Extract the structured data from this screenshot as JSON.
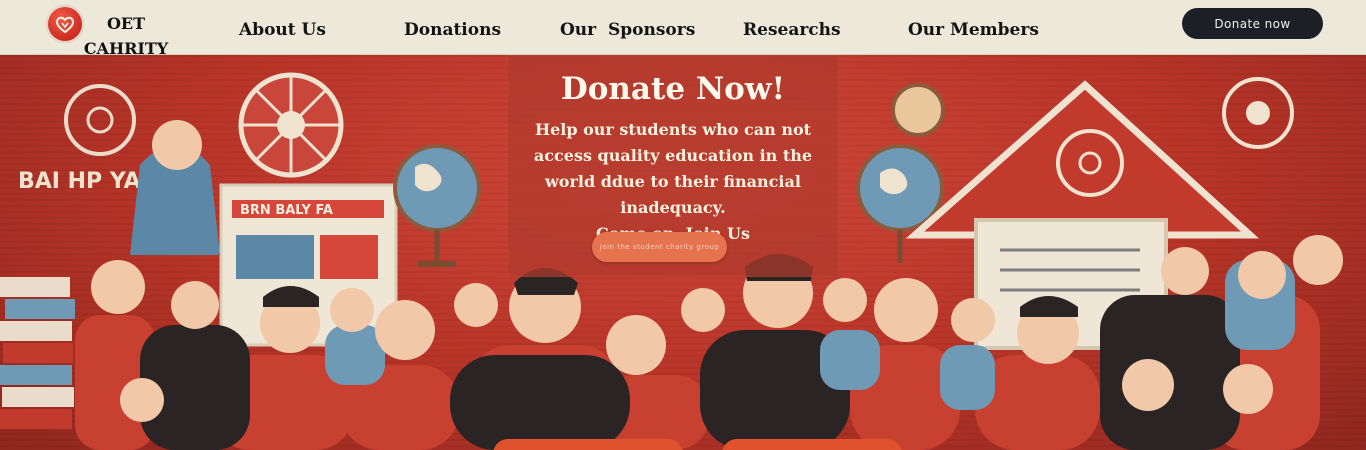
{
  "brand": {
    "name": "OET\nCAHRITY",
    "logo_icon": "heart-logo-icon"
  },
  "nav": {
    "items": [
      {
        "label": "About Us"
      },
      {
        "label": "Donations"
      },
      {
        "label": "Our  Sponsors"
      },
      {
        "label": "Researchs"
      },
      {
        "label": "Our Members"
      }
    ],
    "cta_label": "Donate now"
  },
  "hero": {
    "title": "Donate Now!",
    "text": "Help our students who can not access quality education in the world ddue to their financial inadequacy.",
    "join": "Come on, Join Us",
    "pill_label": "Join the student charity group",
    "sign_left": "BAI HP YAP",
    "board_label": "BRN BALY FA"
  },
  "colors": {
    "nav_bg": "#ece8da",
    "hero_red": "#b73427",
    "panel": "#b03a2d",
    "cta_dark": "#1d1f26",
    "pill_orange": "#e4734e"
  }
}
